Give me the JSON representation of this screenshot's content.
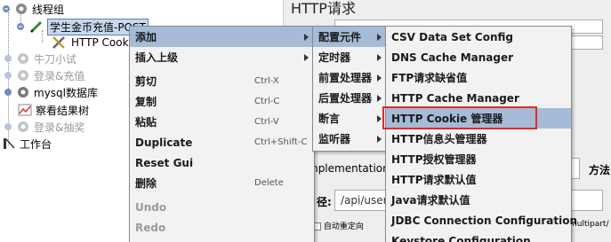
{
  "tree": {
    "items": [
      {
        "label": "线程组",
        "disabled": false
      },
      {
        "label": "学生金币充值-POST",
        "disabled": false,
        "selected": true
      },
      {
        "label": "HTTP Cook",
        "disabled": false
      },
      {
        "label": "牛刀小试",
        "disabled": true
      },
      {
        "label": "登录&充值",
        "disabled": true
      },
      {
        "label": "mysql数据库",
        "disabled": false
      },
      {
        "label": "察看结果树",
        "disabled": false
      },
      {
        "label": "登录&抽奖",
        "disabled": true
      },
      {
        "label": "工作台",
        "disabled": false
      }
    ]
  },
  "background": {
    "panel_title": "HTTP请求",
    "implementation_label": "mplementation",
    "method_label": "方法",
    "path_label": "径:",
    "path_value": "/api/user",
    "redirect_label": "自动重定向",
    "multipart_label": "multipart/"
  },
  "context_menu": {
    "items": [
      {
        "label": "添加",
        "shortcut": "",
        "submenu": true,
        "highlight": true,
        "disabled": false
      },
      {
        "label": "插入上级",
        "shortcut": "",
        "submenu": true,
        "highlight": false,
        "disabled": false
      },
      {
        "label": "剪切",
        "shortcut": "Ctrl-X",
        "submenu": false,
        "highlight": false,
        "disabled": false
      },
      {
        "label": "复制",
        "shortcut": "Ctrl-C",
        "submenu": false,
        "highlight": false,
        "disabled": false
      },
      {
        "label": "粘贴",
        "shortcut": "Ctrl-V",
        "submenu": false,
        "highlight": false,
        "disabled": false
      },
      {
        "label": "Duplicate",
        "shortcut": "Ctrl+Shift-C",
        "submenu": false,
        "highlight": false,
        "disabled": false
      },
      {
        "label": "Reset Gui",
        "shortcut": "",
        "submenu": false,
        "highlight": false,
        "disabled": false
      },
      {
        "label": "删除",
        "shortcut": "Delete",
        "submenu": false,
        "highlight": false,
        "disabled": false
      },
      {
        "label": "Undo",
        "shortcut": "",
        "submenu": false,
        "highlight": false,
        "disabled": true
      },
      {
        "label": "Redo",
        "shortcut": "",
        "submenu": false,
        "highlight": false,
        "disabled": true
      }
    ]
  },
  "add_submenu": {
    "items": [
      {
        "label": "配置元件",
        "highlight": true
      },
      {
        "label": "定时器",
        "highlight": false
      },
      {
        "label": "前置处理器",
        "highlight": false
      },
      {
        "label": "后置处理器",
        "highlight": false
      },
      {
        "label": "断言",
        "highlight": false
      },
      {
        "label": "监听器",
        "highlight": false
      }
    ]
  },
  "config_submenu": {
    "items": [
      {
        "label": "CSV Data Set Config",
        "highlight": false
      },
      {
        "label": "DNS Cache Manager",
        "highlight": false
      },
      {
        "label": "FTP请求缺省值",
        "highlight": false
      },
      {
        "label": "HTTP Cache Manager",
        "highlight": false
      },
      {
        "label": "HTTP Cookie 管理器",
        "highlight": true
      },
      {
        "label": "HTTP信息头管理器",
        "highlight": false
      },
      {
        "label": "HTTP授权管理器",
        "highlight": false
      },
      {
        "label": "HTTP请求默认值",
        "highlight": false
      },
      {
        "label": "Java请求默认值",
        "highlight": false
      },
      {
        "label": "JDBC Connection Configuration",
        "highlight": false
      },
      {
        "label": "Keystore Configuration",
        "highlight": false
      }
    ]
  },
  "colors": {
    "menu_highlight": "#a5bbd7",
    "annotation_box": "#e0292b"
  }
}
